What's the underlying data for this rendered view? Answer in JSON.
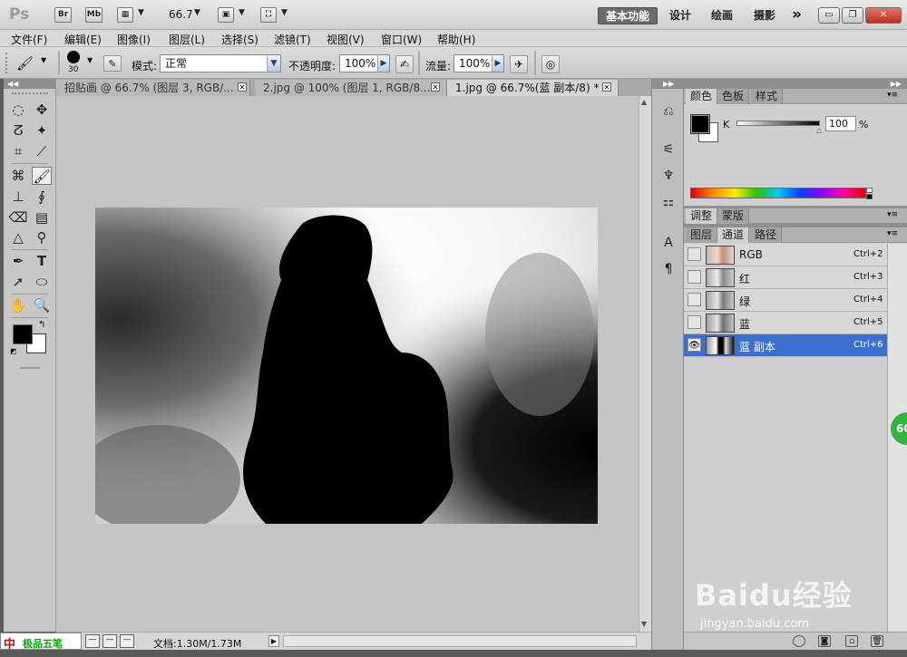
{
  "app": {
    "logo": "Ps"
  },
  "titlebar": {
    "bridge": "Br",
    "minibridge": "Mb",
    "zoom": "66.7",
    "workspaces": [
      "基本功能",
      "设计",
      "绘画",
      "摄影"
    ],
    "more": "»",
    "controls": {
      "minimize": "▭",
      "restore": "❐",
      "close": "✕"
    }
  },
  "menu": {
    "items": [
      "文件(F)",
      "编辑(E)",
      "图像(I)",
      "图层(L)",
      "选择(S)",
      "滤镜(T)",
      "视图(V)",
      "窗口(W)",
      "帮助(H)"
    ]
  },
  "options": {
    "brush_size": "30",
    "mode_label": "模式:",
    "mode_value": "正常",
    "opacity_label": "不透明度:",
    "opacity_value": "100%",
    "flow_label": "流量:",
    "flow_value": "100%"
  },
  "tabs": [
    {
      "label": "招贴画 @ 66.7% (图层 3, RGB/..."
    },
    {
      "label": "2.jpg @ 100% (图层 1, RGB/8..."
    },
    {
      "label": "1.jpg @ 66.7%(蓝 副本/8) *"
    }
  ],
  "status": {
    "doc_info": "文档:1.30M/1.73M",
    "taskbar_label": "极品五笔"
  },
  "color_panel": {
    "tabs": [
      "颜色",
      "色板",
      "样式"
    ],
    "channel_label": "K",
    "value": "100",
    "unit": "%"
  },
  "adjust_panel": {
    "tabs": [
      "调整",
      "蒙版"
    ]
  },
  "channels_panel": {
    "tabs": [
      "图层",
      "通道",
      "路径"
    ],
    "channels": [
      {
        "name": "RGB",
        "shortcut": "Ctrl+2",
        "visible": false,
        "selected": false
      },
      {
        "name": "红",
        "shortcut": "Ctrl+3",
        "visible": false,
        "selected": false
      },
      {
        "name": "绿",
        "shortcut": "Ctrl+4",
        "visible": false,
        "selected": false
      },
      {
        "name": "蓝",
        "shortcut": "Ctrl+5",
        "visible": false,
        "selected": false
      },
      {
        "name": "蓝 副本",
        "shortcut": "Ctrl+6",
        "visible": true,
        "selected": true
      }
    ]
  },
  "badge": "60",
  "watermark": {
    "brand": "Baidu经验",
    "url": "jingyan.baidu.com"
  },
  "colors": {
    "selection": "#3d6fd1",
    "canvas_bg": "#c4c4c4",
    "foreground": "#000000",
    "background": "#ffffff"
  }
}
